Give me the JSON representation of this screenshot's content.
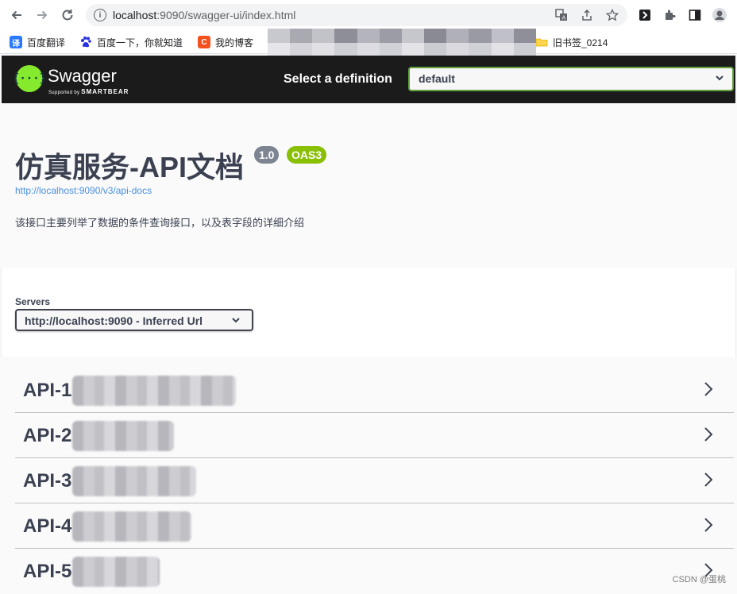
{
  "browser": {
    "url_host": "localhost",
    "url_rest": ":9090/swagger-ui/index.html",
    "bookmarks": [
      {
        "label": "百度翻译",
        "icon": "translate-icon",
        "color": "#2979ff"
      },
      {
        "label": "百度一下，你就知道",
        "icon": "paw-icon",
        "color": "#2932e1"
      },
      {
        "label": "我的博客",
        "icon": "blog-c-icon",
        "color": "#f4511e"
      },
      {
        "label": "旧书签_0214",
        "icon": "folder-icon",
        "color": "#ffd54f"
      }
    ]
  },
  "header": {
    "brand": "Swagger",
    "brand_sub": "Supported by",
    "brand_sub_strong": "SMARTBEAR",
    "select_label": "Select a definition",
    "select_value": "default"
  },
  "info": {
    "title": "仿真服务-API文档",
    "version": "1.0",
    "oas": "OAS3",
    "docs_url": "http://localhost:9090/v3/api-docs",
    "description": "该接口主要列举了数据的条件查询接口，以及表字段的详细介绍"
  },
  "servers": {
    "label": "Servers",
    "selected": "http://localhost:9090 - Inferred Url"
  },
  "tags": [
    {
      "name": "API-1"
    },
    {
      "name": "API-2"
    },
    {
      "name": "API-3"
    },
    {
      "name": "API-4"
    },
    {
      "name": "API-5"
    }
  ],
  "watermark": "CSDN @蛋桃",
  "colors": {
    "swagger_green": "#85ea2d",
    "topbar": "#1b1b1b",
    "title": "#3b4151",
    "version_badge": "#7d8492",
    "oas_badge": "#89bf04",
    "link": "#4990e2",
    "select_border": "#62a03f"
  }
}
